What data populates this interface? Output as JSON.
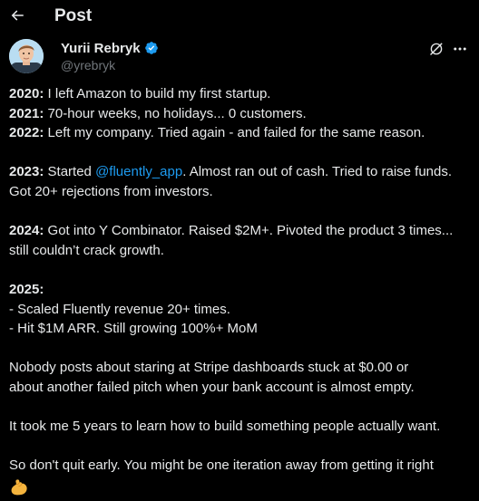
{
  "header": {
    "title": "Post",
    "back_icon": "arrow-left-icon"
  },
  "author": {
    "display_name": "Yurii Rebryk",
    "handle": "@yrebryk",
    "verified_color": "#1d9bf0"
  },
  "tweet": {
    "lines": [
      {
        "bold": "2020:",
        "text": " I left Amazon to build my first startup."
      },
      {
        "bold": "2021:",
        "text": " 70-hour weeks, no holidays... 0 customers."
      },
      {
        "bold": "2022:",
        "text": " Left my company. Tried again - and failed for the same reason."
      },
      {
        "bold": "2023:",
        "pre": " Started ",
        "mention": "@fluently_app",
        "post": ". Almost ran out of cash. Tried to raise funds."
      },
      {
        "text": "Got 20+ rejections from investors."
      },
      {
        "bold": "2024:",
        "text": " Got into Y Combinator. Raised $2M+. Pivoted the product 3 times..."
      },
      {
        "text": "still couldn’t crack growth."
      },
      {
        "bold": "2025:"
      },
      {
        "text": "- Scaled Fluently revenue 20+ times."
      },
      {
        "text": "- Hit $1M ARR. Still growing 100%+ MoM"
      },
      {
        "text": "Nobody posts about staring at Stripe dashboards stuck at $0.00 or"
      },
      {
        "text": "about another failed pitch when your bank account is almost empty."
      },
      {
        "text": "It took me 5 years to learn how to build something people actually want."
      },
      {
        "text": "So don't quit early. You might be one iteration away from getting it right"
      }
    ],
    "emoji": "flexed-biceps-emoji"
  },
  "colors": {
    "background": "#000000",
    "text": "#e7e9ea",
    "secondary": "#71767b",
    "link": "#1d9bf0"
  }
}
